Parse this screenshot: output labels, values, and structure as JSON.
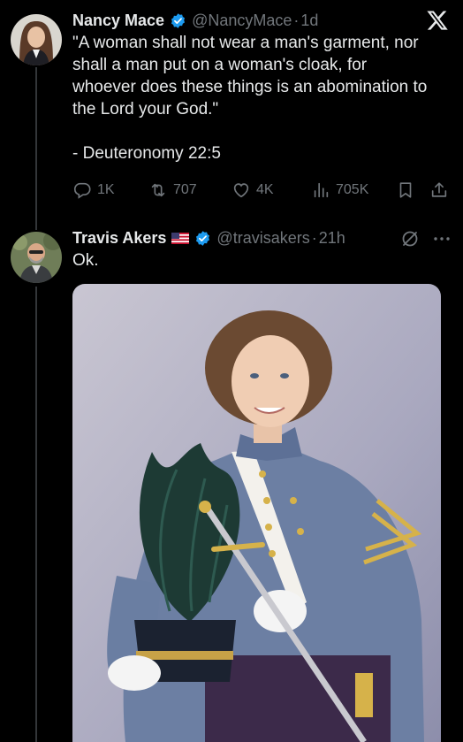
{
  "tweet1": {
    "name": "Nancy Mace",
    "handle": "@NancyMace",
    "time": "1d",
    "body_lines": [
      "\"A woman shall not wear a man's garment, nor",
      "shall a man put on a woman's cloak, for",
      "whoever does these things is an abomination to",
      "the Lord your God.\""
    ],
    "citation": "- Deuteronomy 22:5",
    "stats": {
      "replies": "1K",
      "reposts": "707",
      "likes": "4K",
      "views": "705K"
    }
  },
  "tweet2": {
    "name": "Travis Akers",
    "handle": "@travisakers",
    "time": "21h",
    "text": "Ok."
  },
  "colors": {
    "verified": "#1d9bf0",
    "muted": "#71767b",
    "text": "#e7e9ea"
  },
  "icons": [
    "x-logo-icon",
    "verified-icon",
    "reply-icon",
    "repost-icon",
    "like-icon",
    "views-icon",
    "bookmark-icon",
    "share-icon",
    "us-flag-icon",
    "grok-icon",
    "more-icon"
  ]
}
